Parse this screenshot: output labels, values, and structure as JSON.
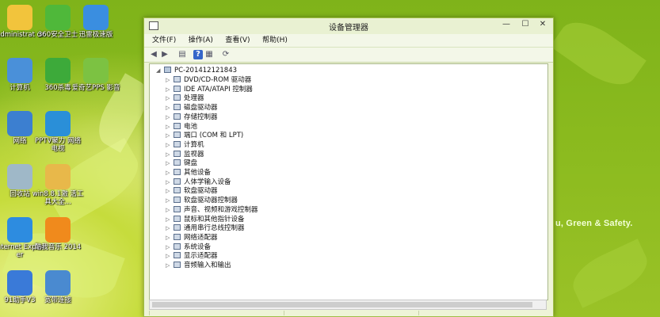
{
  "desktop": {
    "slogan": "u, Green & Safety.",
    "icons": [
      {
        "label": "Administrat or",
        "icon": "user-folder-icon",
        "color": "#f2c43c"
      },
      {
        "label": "360安全卫士",
        "icon": "360-safe-icon",
        "color": "#4fb83a"
      },
      {
        "label": "迅雷极速版",
        "icon": "thunder-bird-icon",
        "color": "#3a8ee0"
      },
      {
        "label": "计算机",
        "icon": "computer-icon",
        "color": "#4a90d9"
      },
      {
        "label": "360杀毒",
        "icon": "360-antivirus-icon",
        "color": "#3daa3a"
      },
      {
        "label": "爱奇艺PPS 影音",
        "icon": "pps-player-icon",
        "color": "#7cc242"
      },
      {
        "label": "网络",
        "icon": "network-globe-icon",
        "color": "#3c7fd0"
      },
      {
        "label": "PPTV聚力 网络电视",
        "icon": "pptv-icon",
        "color": "#2a8fd8"
      },
      {
        "label": "回收站",
        "icon": "recycle-bin-icon",
        "color": "#9fb8c8"
      },
      {
        "label": "win8.8.1激 活工具大全...",
        "icon": "folder-icon",
        "color": "#e8b84a"
      },
      {
        "label": "Internet Explorer",
        "icon": "ie-icon",
        "color": "#2d8ce0"
      },
      {
        "label": "酷我音乐 2014",
        "icon": "kuwo-music-icon",
        "color": "#f08a1c"
      },
      {
        "label": "91助手V3",
        "icon": "91-assistant-icon",
        "color": "#3a7ad8"
      },
      {
        "label": "宽带连接",
        "icon": "broadband-icon",
        "color": "#4a8ad0"
      }
    ]
  },
  "window": {
    "title": "设备管理器",
    "controls": {
      "minimize": "—",
      "maximize": "☐",
      "close": "✕"
    },
    "menu": [
      "文件(F)",
      "操作(A)",
      "查看(V)",
      "帮助(H)"
    ],
    "toolbar": [
      {
        "name": "back-icon",
        "glyph": "◀"
      },
      {
        "name": "forward-icon",
        "glyph": "▶"
      },
      {
        "name": "console-tree-icon",
        "glyph": "▤"
      },
      {
        "name": "help-icon",
        "glyph": "?"
      },
      {
        "name": "properties-icon",
        "glyph": "▦"
      },
      {
        "name": "scan-hardware-icon",
        "glyph": "⟳"
      }
    ],
    "tree": {
      "root": "PC-201412121843",
      "items": [
        "DVD/CD-ROM 驱动器",
        "IDE ATA/ATAPI 控制器",
        "处理器",
        "磁盘驱动器",
        "存储控制器",
        "电池",
        "端口 (COM 和 LPT)",
        "计算机",
        "监视器",
        "键盘",
        "其他设备",
        "人体学输入设备",
        "软盘驱动器",
        "软盘驱动器控制器",
        "声音、视频和游戏控制器",
        "鼠标和其他指针设备",
        "通用串行总线控制器",
        "网络适配器",
        "系统设备",
        "显示适配器",
        "音频输入和输出"
      ]
    }
  }
}
